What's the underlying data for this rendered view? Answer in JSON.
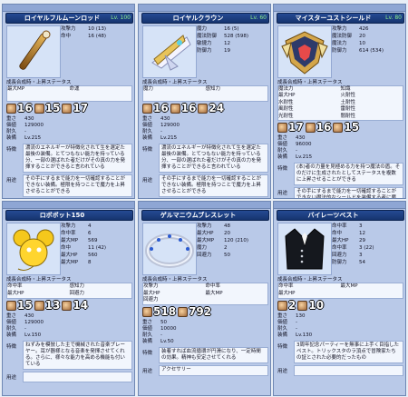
{
  "labels": {
    "growth": "成長合成時・上昇ステータス",
    "materials": "材料一覧",
    "required_level": "Lv.215"
  },
  "panels": [
    {
      "title": "ロイヤルフルムーンロッド",
      "level": "Lv. 100",
      "stats": [
        [
          "攻撃力",
          "10 (13)"
        ],
        [
          "命中",
          "16 (48)"
        ]
      ],
      "growth": [
        "最大MP",
        "命運",
        ""
      ],
      "mats": [
        "16",
        "15",
        "17"
      ],
      "req": [
        [
          "重さ",
          "430"
        ],
        [
          "価値",
          "129000"
        ],
        [
          "耐久",
          "-"
        ],
        [
          "装備",
          "Lv.215"
        ]
      ],
      "feature": "濃流のエネルギーが特徴化されて生を選定た最後の装備。とてつもない能力を持っている分、一部の選ばれた者だけがその真の力を発揮することができると言われている",
      "usage": "その手にするまで能力を一切確認することができない装備。極限を持つことで魔力を上昇させることができる"
    },
    {
      "title": "ロイヤルクラウン",
      "level": "Lv. 60",
      "stats": [
        [
          "魔力",
          "16 (5)"
        ],
        [
          "魔法防御",
          "528 (598)"
        ],
        [
          "敏捷力",
          "12"
        ],
        [
          "防御力",
          "19"
        ]
      ],
      "growth": [
        "魔力",
        "感知力",
        ""
      ],
      "mats": [
        "16",
        "16",
        "24"
      ],
      "req": [
        [
          "重さ",
          "430"
        ],
        [
          "価値",
          "129000"
        ],
        [
          "耐久",
          "-"
        ],
        [
          "装備",
          "Lv.215"
        ]
      ],
      "feature": "濃流のエネルギーが特徴化されて生を選定た最後の装備。とてつもない能力を持っている分、一部の選ばれた者だけがその真の力を発揮することができると言われている",
      "usage": "その手にするまで能力を一切確認することができない装備。極限を持つことで魔力を上昇させることができる"
    },
    {
      "title": "マイスターユストシールド",
      "level": "Lv. 80",
      "stats": [
        [
          "攻撃力",
          "426"
        ],
        [
          "魔法防御",
          "20"
        ],
        [
          "魔法力",
          "10"
        ],
        [
          "防御力",
          "614 (534)"
        ]
      ],
      "growth": [
        "魔法力",
        "知識",
        "最大HP",
        "火耐性",
        "水耐性",
        "土耐性",
        "風耐性",
        "雷耐性",
        "光耐性",
        "闇耐性"
      ],
      "mats": [
        "17",
        "16",
        "15"
      ],
      "req": [
        [
          "重さ",
          "430"
        ],
        [
          "価値",
          "96000"
        ],
        [
          "耐久",
          "-"
        ],
        [
          "装備",
          "Lv.215"
        ]
      ],
      "feature": "(本)者の力量を見極める力を持つ魔法の盾。そのだけに生成されたとしてステータスを複数に上昇させることができる",
      "usage": "その手にするまで能力を一切確認することができない魔法的なシールドを装備する者に魔能。どんな仕様が不明な力の恩恵を受けることもできる"
    },
    {
      "title": "ロボボット150",
      "level": "",
      "stats": [
        [
          "攻撃力",
          "4"
        ],
        [
          "命中率",
          "6"
        ],
        [
          "最大MP",
          "569"
        ],
        [
          "命中",
          "11 (42)"
        ],
        [
          "最大HP",
          "560"
        ],
        [
          "最大MP",
          "8"
        ]
      ],
      "growth": [
        "命中率",
        "感知力",
        "最大HP",
        "回避力"
      ],
      "mats": [
        "15",
        "13",
        "14"
      ],
      "req": [
        [
          "重さ",
          "430"
        ],
        [
          "価値",
          "129000"
        ],
        [
          "耐久",
          "-"
        ],
        [
          "装備",
          "Lv.150"
        ]
      ],
      "feature": "ねずみを模倣した主で機械された音楽プレーヤー。耳が器様となる音楽を発揮させてくれる。さらに、様々な能力を高める機能も付いている",
      "usage": ""
    },
    {
      "title": "ゲルマニウムブレスレット",
      "level": "",
      "stats": [
        [
          "攻撃力",
          "48"
        ],
        [
          "最大HP",
          "20"
        ],
        [
          "最大MP",
          "120 (210)"
        ],
        [
          "魔力",
          "2"
        ],
        [
          "回避力",
          "50"
        ]
      ],
      "growth": [
        "攻撃力",
        "命中率",
        "最大HP",
        "最大MP",
        "回避力",
        ""
      ],
      "mats": [
        "518",
        "792"
      ],
      "req": [
        [
          "重さ",
          "50"
        ],
        [
          "価値",
          "10000"
        ],
        [
          "耐久",
          "-"
        ],
        [
          "装備",
          "Lv.50"
        ]
      ],
      "feature": "装着すれば血流循環が円滑になり、一定時間の効果。精神も安定させてくれる",
      "usage": "アクセサリー"
    },
    {
      "title": "バイレーツベスト",
      "level": "",
      "stats": [
        [
          "命中率",
          "3"
        ],
        [
          "命中",
          "12"
        ],
        [
          "最大HP",
          "29"
        ],
        [
          "命中率",
          "3 (22)"
        ],
        [
          "回避力",
          "3"
        ],
        [
          "防御力",
          "54"
        ]
      ],
      "growth": [
        "命中率",
        "最大MP",
        "最大HP",
        ""
      ],
      "mats": [
        "2",
        "10"
      ],
      "req": [
        [
          "重さ",
          "130"
        ],
        [
          "価値",
          "-"
        ],
        [
          "耐久",
          "-"
        ],
        [
          "装備",
          "Lv.130"
        ]
      ],
      "feature": "3周年記念パーティーを無事に上手く目指したペスト。トリックスタのラ頂点で冒険家たちの証とされた必要的だったもの",
      "usage": ""
    }
  ]
}
